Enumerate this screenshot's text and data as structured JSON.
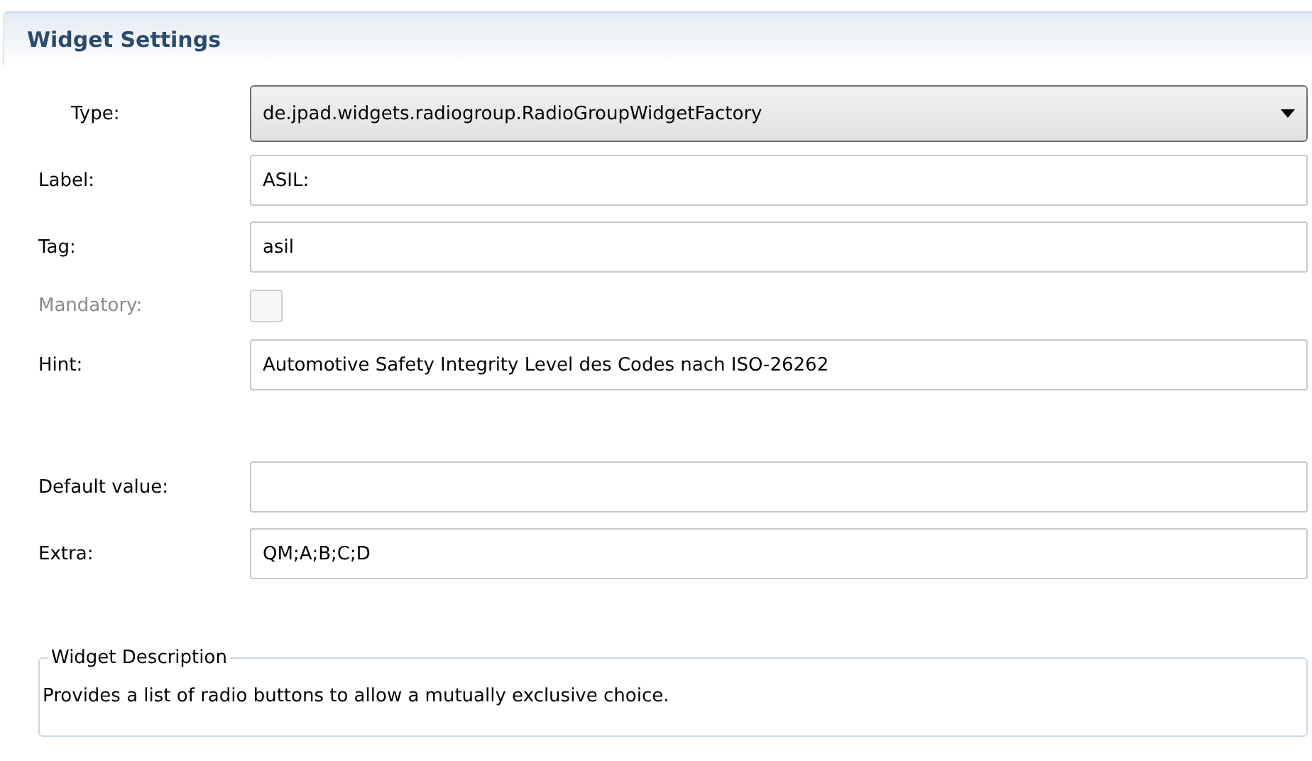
{
  "section": {
    "title": "Widget Settings"
  },
  "field_groups": [
    [
      {
        "kind": "combo",
        "label": "Type:",
        "value": "de.jpad.widgets.radiogroup.RadioGroupWidgetFactory",
        "disabled": false
      },
      {
        "kind": "text",
        "label": "Label:",
        "value": "ASIL:",
        "disabled": false
      },
      {
        "kind": "text",
        "label": "Tag:",
        "value": "asil",
        "disabled": false
      },
      {
        "kind": "checkbox",
        "label": "Mandatory:",
        "checked": false,
        "disabled": true
      },
      {
        "kind": "text",
        "label": "Hint:",
        "value": "Automotive Safety Integrity Level des Codes nach ISO-26262",
        "disabled": false
      }
    ],
    [
      {
        "kind": "text",
        "label": "Default value:",
        "disabled": false
      },
      {
        "kind": "text",
        "label": "Extra:",
        "value": "QM;A;B;C;D",
        "disabled": false
      }
    ]
  ],
  "description": {
    "title": "Widget Description",
    "text": "Provides a list of radio buttons to allow a mutually exclusive choice."
  }
}
